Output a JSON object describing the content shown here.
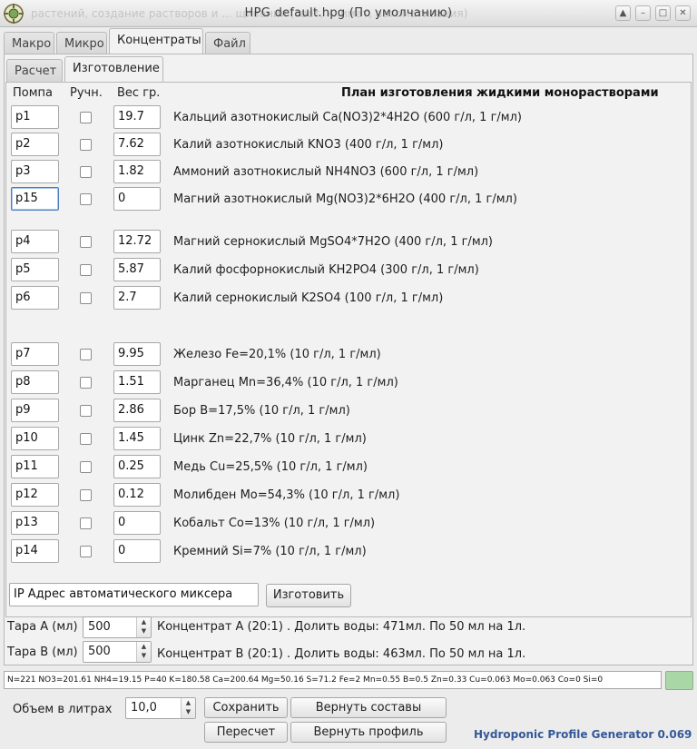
{
  "window": {
    "title": "HPG default.hpg (По умолчанию)",
    "background_text": "растений, создание растворов и ... щивания (свет, климат, автоматизация)"
  },
  "main_tabs": [
    {
      "label": "Макро",
      "active": false
    },
    {
      "label": "Микро",
      "active": false
    },
    {
      "label": "Концентраты",
      "active": true
    },
    {
      "label": "Файл",
      "active": false
    }
  ],
  "sub_tabs": [
    {
      "label": "Расчет",
      "active": false
    },
    {
      "label": "Изготовление",
      "active": true
    }
  ],
  "headers": {
    "pump": "Помпа",
    "manual": "Ручн.",
    "weight": "Вес гр.",
    "plan_title": "План изготовления жидкими монорастворами"
  },
  "rows": [
    {
      "pump": "p1",
      "weight": "19.7",
      "label": "Кальций азотнокислый Ca(NO3)2*4H2O (600 г/л, 1 г/мл)",
      "manual": false
    },
    {
      "pump": "p2",
      "weight": "7.62",
      "label": "Калий азотнокислый KNO3 (400 г/л, 1 г/мл)",
      "manual": false
    },
    {
      "pump": "p3",
      "weight": "1.82",
      "label": "Аммоний азотнокислый NH4NO3 (600 г/л, 1 г/мл)",
      "manual": false
    },
    {
      "pump": "p15",
      "weight": "0",
      "label": "Магний азотнокислый Mg(NO3)2*6H2O (400 г/л, 1 г/мл)",
      "manual": false
    },
    {
      "pump": "p4",
      "weight": "12.72",
      "label": "Магний сернокислый MgSO4*7H2O (400 г/л, 1 г/мл)",
      "manual": false
    },
    {
      "pump": "p5",
      "weight": "5.87",
      "label": "Калий фосфорнокислый KH2PO4 (300 г/л, 1 г/мл)",
      "manual": false
    },
    {
      "pump": "p6",
      "weight": "2.7",
      "label": "Калий сернокислый K2SO4 (100 г/л, 1 г/мл)",
      "manual": false
    },
    {
      "pump": "p7",
      "weight": "9.95",
      "label": "Железо Fe=20,1% (10 г/л, 1 г/мл)",
      "manual": false
    },
    {
      "pump": "p8",
      "weight": "1.51",
      "label": "Марганец Mn=36,4% (10 г/л, 1 г/мл)",
      "manual": false
    },
    {
      "pump": "p9",
      "weight": "2.86",
      "label": "Бор B=17,5% (10 г/л, 1 г/мл)",
      "manual": false
    },
    {
      "pump": "p10",
      "weight": "1.45",
      "label": "Цинк Zn=22,7% (10 г/л, 1 г/мл)",
      "manual": false
    },
    {
      "pump": "p11",
      "weight": "0.25",
      "label": "Медь Cu=25,5% (10 г/л, 1 г/мл)",
      "manual": false
    },
    {
      "pump": "p12",
      "weight": "0.12",
      "label": "Молибден Mo=54,3% (10 г/л, 1 г/мл)",
      "manual": false
    },
    {
      "pump": "p13",
      "weight": "0",
      "label": "Кобальт Co=13% (10 г/л, 1 г/мл)",
      "manual": false
    },
    {
      "pump": "p14",
      "weight": "0",
      "label": "Кремний Si=7% (10 г/л, 1 г/мл)",
      "manual": false
    }
  ],
  "mixer": {
    "ip_value": "IP Адрес автоматического миксера",
    "make_button": "Изготовить"
  },
  "tara_a": {
    "label": "Тара A (мл)",
    "value": "500",
    "info": "Концентрат A (20:1) . Долить воды: 471мл. По 50 мл на 1л."
  },
  "tara_b": {
    "label": "Тара B (мл)",
    "value": "500",
    "info": "Концентрат B (20:1) . Долить воды: 463мл. По 50 мл на 1л."
  },
  "status": {
    "text": "N=221 NO3=201.61 NH4=19.15 P=40 K=180.58 Ca=200.64 Mg=50.16 S=71.2 Fe=2 Mn=0.55 B=0.5 Zn=0.33 Cu=0.063 Mo=0.063 Co=0 Si=0",
    "led_color": "#a9d8a6"
  },
  "bottom": {
    "volume_label": "Объем в литрах",
    "volume_value": "10,0",
    "save": "Сохранить",
    "restore_compositions": "Вернуть составы",
    "recalc": "Пересчет",
    "restore_profile": "Вернуть профиль",
    "brand": "Hydroponic Profile Generator 0.069"
  },
  "colors": {
    "brand": "#35589a",
    "focus": "#4a7fc1"
  }
}
